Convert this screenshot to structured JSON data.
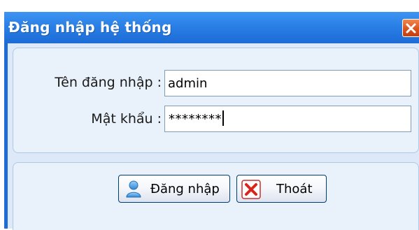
{
  "window": {
    "title": "Đăng nhập hệ thống",
    "close_icon": "close-icon"
  },
  "form": {
    "username_label": "Tên đăng nhập :",
    "username_value": "admin",
    "password_label": "Mật khẩu :",
    "password_value": "********"
  },
  "buttons": {
    "login_label": "Đăng nhập",
    "login_icon": "user-icon",
    "exit_label": "Thoát",
    "exit_icon": "close-x-icon"
  },
  "colors": {
    "titlebar": "#2a7fe6",
    "close_button": "#d9501c",
    "panel_background": "#e9f1fb"
  }
}
